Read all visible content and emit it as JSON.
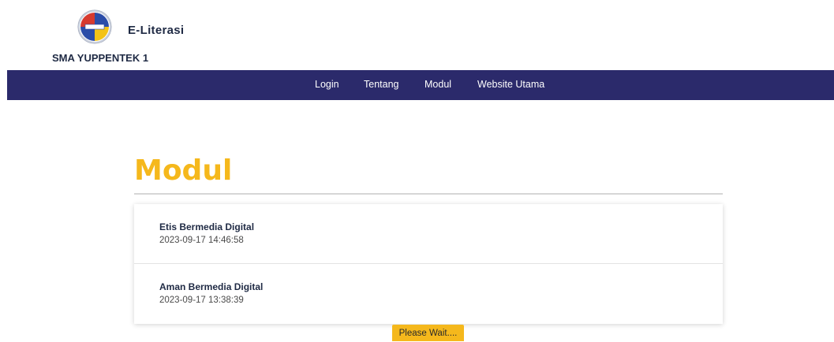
{
  "header": {
    "app_name": "E-Literasi",
    "school_name": "SMA YUPPENTEK 1",
    "logo_icon": "school-emblem-icon"
  },
  "nav": {
    "items": [
      {
        "label": "Login"
      },
      {
        "label": "Tentang"
      },
      {
        "label": "Modul"
      },
      {
        "label": "Website Utama"
      }
    ]
  },
  "main": {
    "title": "Modul",
    "modules": [
      {
        "title": "Etis Bermedia Digital",
        "date": "2023-09-17 14:46:58"
      },
      {
        "title": "Aman Bermedia Digital",
        "date": "2023-09-17 13:38:39"
      }
    ]
  },
  "loading": {
    "text": "Please Wait...."
  },
  "colors": {
    "navbar": "#2b2a6b",
    "accent": "#f5b81c"
  }
}
